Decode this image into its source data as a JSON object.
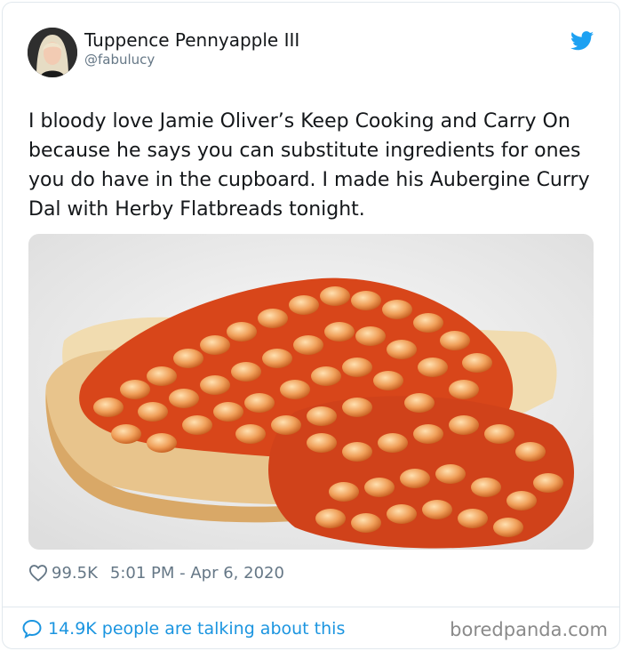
{
  "author": {
    "display_name": "Tuppence Pennyapple III",
    "handle": "@fabulucy",
    "avatar_icon": "profile-photo"
  },
  "brand": {
    "icon": "twitter-bird-icon",
    "color": "#1da1f2"
  },
  "tweet": {
    "text": "I bloody love Jamie Oliver’s Keep Cooking and Carry On because he says you can substitute ingredients for ones you do have in the cupboard. I made his Aubergine Curry Dal with Herby Flatbreads tonight.",
    "image_icon": "beans-on-toast-photo"
  },
  "meta": {
    "likes": "99.5K",
    "timestamp": "5:01 PM - Apr 6, 2020",
    "heart_icon": "heart-icon"
  },
  "footer": {
    "talking": "14.9K people are talking about this",
    "talking_icon": "speech-bubble-icon",
    "link_color": "#1b95e0"
  },
  "watermark": "boredpanda.com"
}
